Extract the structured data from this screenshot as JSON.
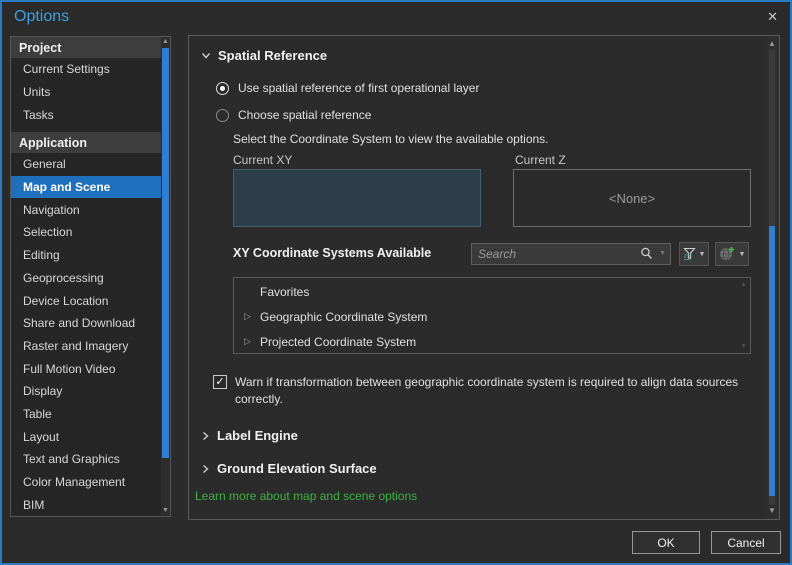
{
  "titlebar": {
    "title": "Options",
    "close_glyph": "✕"
  },
  "sidebar": {
    "sections": [
      {
        "header": "Project",
        "items": [
          "Current Settings",
          "Units",
          "Tasks"
        ]
      },
      {
        "header": "Application",
        "items": [
          "General",
          "Map and Scene",
          "Navigation",
          "Selection",
          "Editing",
          "Geoprocessing",
          "Device Location",
          "Share and Download",
          "Raster and Imagery",
          "Full Motion Video",
          "Display",
          "Table",
          "Layout",
          "Text and Graphics",
          "Color Management",
          "BIM"
        ]
      }
    ],
    "selected_item": "Map and Scene"
  },
  "main": {
    "spatial_reference": {
      "title": "Spatial Reference",
      "radio_options": [
        {
          "label": "Use spatial reference of first operational layer",
          "selected": true
        },
        {
          "label": "Choose spatial reference",
          "selected": false
        }
      ],
      "instruction": "Select the Coordinate System to view the available options.",
      "current_xy_label": "Current XY",
      "current_z_label": "Current Z",
      "current_z_value": "<None>",
      "xy_available_label": "XY Coordinate Systems Available",
      "search_placeholder": "Search",
      "tree_items": [
        {
          "label": "Favorites",
          "expandable": false
        },
        {
          "label": "Geographic Coordinate System",
          "expandable": true
        },
        {
          "label": "Projected Coordinate System",
          "expandable": true
        }
      ],
      "warn_checkbox": {
        "checked": true,
        "label": "Warn if transformation between geographic coordinate system is required to align data sources correctly."
      }
    },
    "collapsed_sections": [
      "Label Engine",
      "Ground Elevation Surface"
    ],
    "learn_more_link": "Learn more about map and scene options"
  },
  "footer": {
    "ok_label": "OK",
    "cancel_label": "Cancel"
  },
  "icons": {
    "check_glyph": "✓",
    "caret_down_glyph": "▼",
    "scroll_up_glyph": "▲",
    "scroll_down_glyph": "▼",
    "expander_glyph": "▷"
  },
  "colors": {
    "accent_blue": "#2e7fd2",
    "selected_item_bg": "#1e6fbe",
    "dialog_border": "#2a7ac4",
    "title_text": "#3ba0e0",
    "link_green": "#3fb044",
    "current_xy_fill": "#2c3e49",
    "background": "#2b2b2b"
  }
}
